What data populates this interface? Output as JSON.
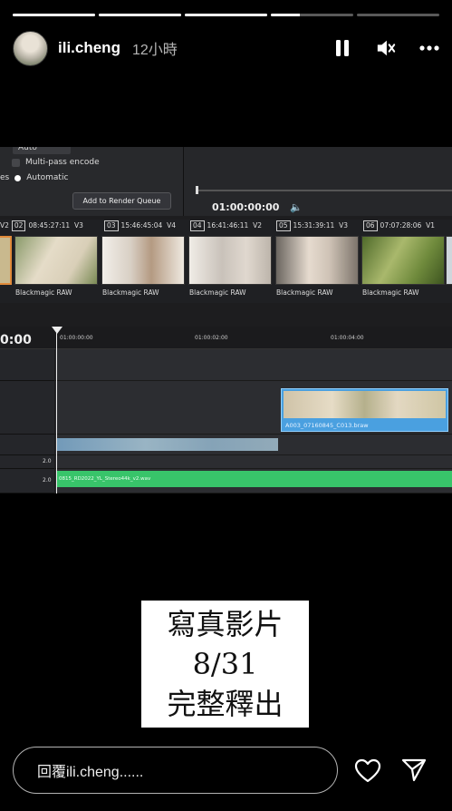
{
  "progress": [
    1,
    1,
    1,
    0.35,
    0
  ],
  "header": {
    "username": "ili.cheng",
    "time": "12小時",
    "pause_icon": "pause-icon",
    "mute_icon": "speaker-muted-icon",
    "more_icon": "more-horizontal-icon"
  },
  "editor": {
    "dropdown_value": "Auto",
    "multipass_label": "Multi-pass encode",
    "radio_prefix": "es",
    "radio_label": "Automatic",
    "render_button": "Add to Render Queue",
    "timecode": "01:00:00:00",
    "clip_headers": [
      {
        "pre": "V2",
        "num": "02",
        "tc": "08:45:27:11",
        "track": "V3"
      },
      {
        "pre": "",
        "num": "03",
        "tc": "15:46:45:04",
        "track": "V4"
      },
      {
        "pre": "",
        "num": "04",
        "tc": "16:41:46:11",
        "track": "V2"
      },
      {
        "pre": "",
        "num": "05",
        "tc": "15:31:39:11",
        "track": "V3"
      },
      {
        "pre": "",
        "num": "06",
        "tc": "07:07:28:06",
        "track": "V1"
      }
    ],
    "clip_labels": [
      "Blackmagic RAW",
      "Blackmagic RAW",
      "Blackmagic RAW",
      "Blackmagic RAW",
      "Blackmagic RAW"
    ],
    "big_timecode": "0:00",
    "ruler": [
      "01:00:00:00",
      "01:00:02:00",
      "01:00:04:00"
    ],
    "video_clip_name": "A003_07160845_C013.braw",
    "audio_clip_name": "0815_RD2022_YL_Stereo44k_v2.wav",
    "audio_levels": [
      "2.0",
      "2.0"
    ]
  },
  "promo": {
    "line1": "寫真影片",
    "line2": "8/31",
    "line3": "完整釋出"
  },
  "footer": {
    "reply_placeholder": "回覆ili.cheng......",
    "heart_icon": "heart-icon",
    "send_icon": "send-icon"
  }
}
